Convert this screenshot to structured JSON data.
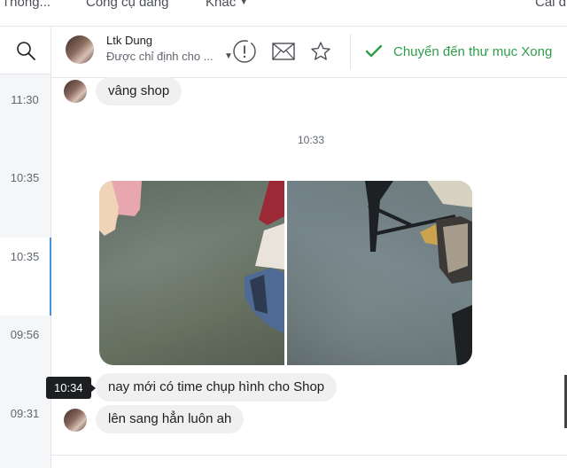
{
  "topnav": {
    "items": [
      {
        "label": "Thông..."
      },
      {
        "label": "Công cụ đăng"
      },
      {
        "label": "Khác"
      },
      {
        "label": "Cài đ"
      }
    ]
  },
  "timeline": {
    "times": [
      "11:30",
      "10:35",
      "10:35",
      "09:56",
      "09:31"
    ]
  },
  "header": {
    "name": "Ltk Dung",
    "subtitle": "Được chỉ định cho ...",
    "done_label": "Chuyển đến thư mục Xong"
  },
  "chat": {
    "messages": [
      {
        "text": "vâng shop"
      },
      {
        "text": "nay mới có time chụp hình cho Shop"
      },
      {
        "text": "lên sang hẳn luôn ah"
      }
    ],
    "center_time": "10:33",
    "hover_time": "10:34"
  },
  "colors": {
    "accent": "#4a90e2",
    "done": "#2e9e4a",
    "bubble": "#f1f0f0"
  }
}
